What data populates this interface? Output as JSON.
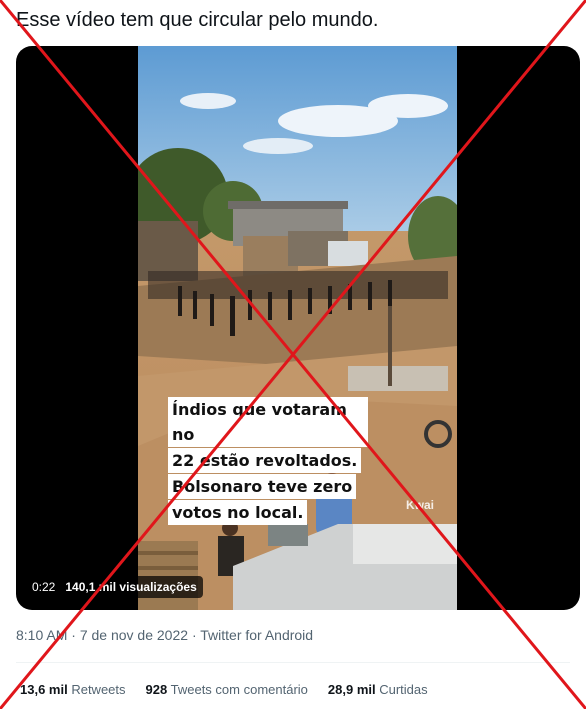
{
  "tweet": {
    "text": "Esse vídeo tem que circular pelo mundo."
  },
  "video": {
    "caption_lines": [
      "Índios que votaram no",
      "22 estão revoltados.",
      "Bolsonaro teve zero",
      "votos no local."
    ],
    "watermark": "Kwai",
    "duration": "0:22",
    "views": "140,1 mil visualizações"
  },
  "meta": {
    "time": "8:10 AM",
    "separator": "·",
    "date": "7 de nov de 2022",
    "separator2": "·",
    "source": "Twitter for Android"
  },
  "stats": {
    "retweets_count": "13,6 mil",
    "retweets_label": "Retweets",
    "quotes_count": "928",
    "quotes_label": "Tweets com comentário",
    "likes_count": "28,9 mil",
    "likes_label": "Curtidas"
  },
  "colors": {
    "cross": "#e0161b",
    "secondary_text": "#536471"
  }
}
